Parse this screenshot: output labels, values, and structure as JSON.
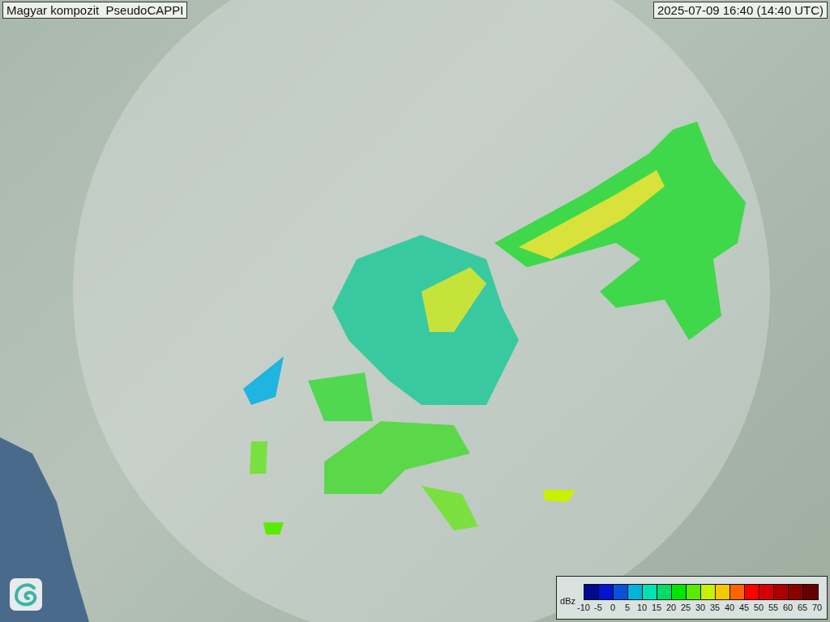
{
  "title": "Magyar kompozit  PseudoCAPPI",
  "timestamp": "2025-07-09 16:40 (14:40 UTC)",
  "legend": {
    "unit": "dBz",
    "bins": [
      {
        "color": "#000a8c"
      },
      {
        "color": "#0014d2"
      },
      {
        "color": "#0a50dc"
      },
      {
        "color": "#00b4dc"
      },
      {
        "color": "#00e1b4"
      },
      {
        "color": "#00dc64"
      },
      {
        "color": "#00e600"
      },
      {
        "color": "#5aeb00"
      },
      {
        "color": "#c8f000"
      },
      {
        "color": "#f5c800"
      },
      {
        "color": "#ff6400"
      },
      {
        "color": "#ff0000"
      },
      {
        "color": "#d70000"
      },
      {
        "color": "#af0000"
      },
      {
        "color": "#8c0000"
      },
      {
        "color": "#640000"
      }
    ],
    "ticks": [
      "-10",
      "-5",
      "0",
      "5",
      "10",
      "15",
      "20",
      "25",
      "30",
      "35",
      "40",
      "45",
      "50",
      "55",
      "60",
      "65",
      "70"
    ]
  }
}
